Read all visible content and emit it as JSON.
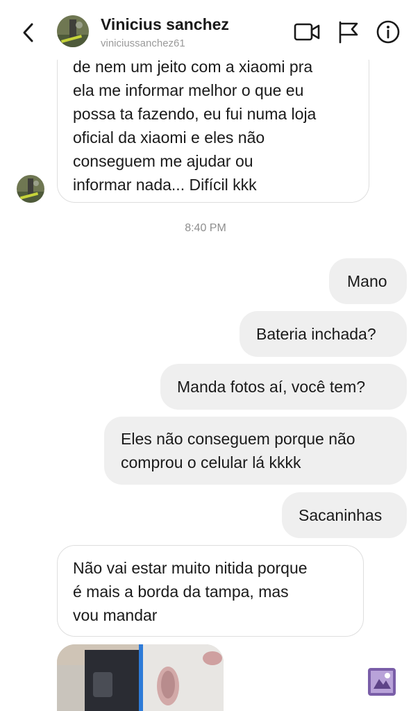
{
  "header": {
    "name": "Vinicius sanchez",
    "username": "viniciussanchez61",
    "icons": [
      "back-chevron-icon",
      "video-call-icon",
      "flag-icon",
      "info-icon"
    ]
  },
  "messages": {
    "incoming_1": [
      "de nem um jeito com a xiaomi pra",
      "ela me informar melhor o que eu",
      "possa ta fazendo, eu fui numa loja",
      "oficial da xiaomi e eles não",
      "conseguem me ajudar ou",
      "informar nada... Difícil kkk"
    ],
    "timestamp": "8:40 PM",
    "outgoing": [
      [
        "Mano"
      ],
      [
        "Bateria inchada?"
      ],
      [
        "Manda fotos aí, você tem?"
      ],
      [
        "Eles não conseguem porque não",
        "comprou o celular lá kkkk"
      ],
      [
        "Sacaninhas"
      ]
    ],
    "incoming_2": [
      "Não vai estar muito nitida porque",
      "é mais a borda da tampa, mas",
      "vou mandar"
    ]
  },
  "colors": {
    "outgoing_bubble": "#efefef",
    "incoming_border": "#dedede",
    "timestamp": "#8e8e8e",
    "username": "#9a9a9a"
  }
}
